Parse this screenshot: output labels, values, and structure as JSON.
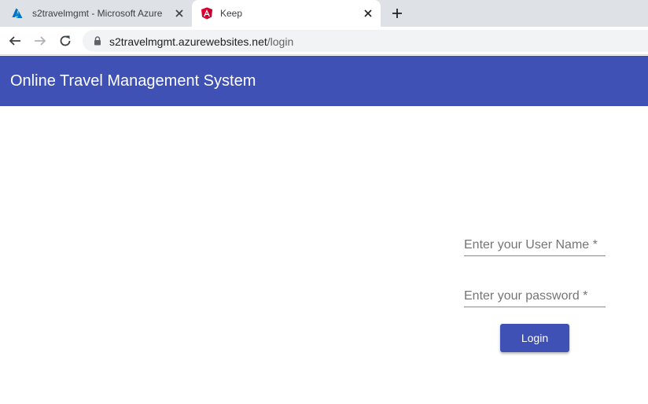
{
  "browser": {
    "tabs": [
      {
        "title": "s2travelmgmt - Microsoft Azure",
        "icon": "azure-icon",
        "active": false
      },
      {
        "title": "Keep",
        "icon": "angular-icon",
        "active": true
      }
    ],
    "address": {
      "host": "s2travelmgmt.azurewebsites.net",
      "path": "/login"
    }
  },
  "app": {
    "title": "Online Travel Management System",
    "brand_color": "#3f51b5"
  },
  "login": {
    "username_placeholder": "Enter your User Name *",
    "password_placeholder": "Enter your password *",
    "button_label": "Login"
  }
}
